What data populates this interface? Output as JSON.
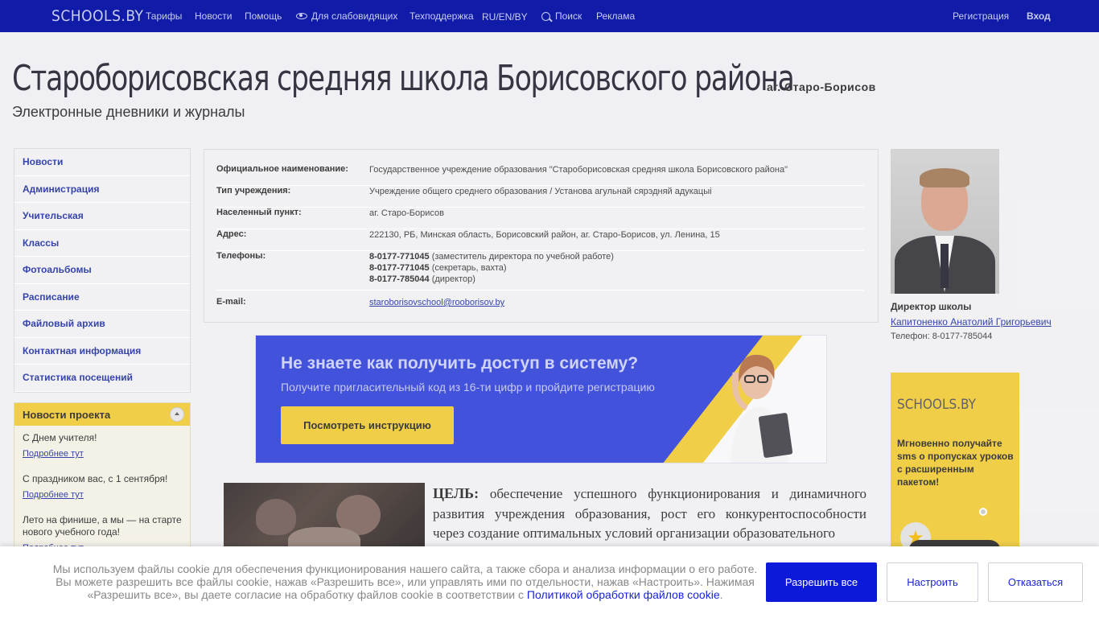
{
  "topbar": {
    "logo": "SCHOOLS.BY",
    "nav": {
      "tariffs": "Тарифы",
      "news": "Новости",
      "help": "Помощь",
      "accessibility": "Для слабовидящих",
      "support": "Техподдержка",
      "languages": "RU/EN/BY",
      "search": "Поиск",
      "ads": "Реклама"
    },
    "register": "Регистрация",
    "login": "Вход"
  },
  "header": {
    "title": "Староборисовская средняя школа Борисовского района",
    "locality": "аг. Старо-Борисов",
    "subtitle": "Электронные дневники и журналы"
  },
  "sidebar": {
    "items": [
      {
        "label": "Новости"
      },
      {
        "label": "Администрация"
      },
      {
        "label": "Учительская"
      },
      {
        "label": "Классы"
      },
      {
        "label": "Фотоальбомы"
      },
      {
        "label": "Расписание"
      },
      {
        "label": "Файловый архив"
      },
      {
        "label": "Контактная информация"
      },
      {
        "label": "Статистика посещений"
      }
    ]
  },
  "project_news": {
    "title": "Новости проекта",
    "entries": [
      {
        "text": "С Днем учителя!",
        "link": "Подробнее тут"
      },
      {
        "text": "С праздником вас, с 1 сентября!",
        "link": "Подробнее тут"
      },
      {
        "text": "Лето на финише, а мы — на старте нового учебного года!",
        "link": "Подробнее тут"
      }
    ]
  },
  "info": {
    "official_name_label": "Официальное наименование:",
    "official_name": "Государственное учреждение образования \"Староборисовская средняя школа Борисовского района\"",
    "type_label": "Тип учреждения:",
    "type": "Учреждение общего среднего образования / Установа агульнай сярэдняй адукацыі",
    "locality_label": "Населенный пункт:",
    "locality": "аг. Старо-Борисов",
    "address_label": "Адрес:",
    "address": "222130, РБ, Минская область, Борисовский район, аг. Старо-Борисов, ул. Ленина, 15",
    "phones_label": "Телефоны:",
    "phones": [
      {
        "number": "8-0177-771045",
        "note": "(заместитель директора по учебной работе)"
      },
      {
        "number": "8-0177-771045",
        "note": "(секретарь, вахта)"
      },
      {
        "number": "8-0177-785044",
        "note": "(директор)"
      }
    ],
    "email_label": "E-mail:",
    "email": "staroborisovschool@rooborisov.by"
  },
  "banner": {
    "title": "Не знаете как получить доступ в систему?",
    "subtitle": "Получите пригласительный код из 16-ти цифр и пройдите регистрацию",
    "button": "Посмотреть инструкцию"
  },
  "goal": {
    "label": "ЦЕЛЬ:",
    "text": "обеспечение успешного функционирования и динамичного развития учреждения образования, рост его конкурентоспособности через создание оптимальных условий организации образовательного"
  },
  "director": {
    "title": "Директор школы",
    "name": "Капитоненко Анатолий Григорьевич",
    "phone": "Телефон: 8-0177-785044"
  },
  "ad": {
    "logo": "SCHOOLS.BY",
    "text": "Мгновенно получайте sms о пропусках уроков с расширенным пакетом!"
  },
  "cookie": {
    "text_line1": "Мы используем файлы cookie для обеспечения функционирования нашего сайта, а также сбора и анализа информации о его работе.",
    "text_line2": "Вы можете разрешить все файлы cookie, нажав «Разрешить все», или управлять ими по отдельности, нажав «Настроить». Нажимая",
    "text_line3": "«Разрешить все», вы даете согласие на обработку файлов cookie в соответствии с",
    "policy_link": "Политикой обработки файлов cookie",
    "allow_all": "Разрешить все",
    "configure": "Настроить",
    "decline": "Отказаться"
  },
  "colors": {
    "topbar": "#101ca8",
    "accent_yellow": "#f0c82f",
    "link": "#1a2aa0",
    "primary_button": "#0d19d9"
  }
}
